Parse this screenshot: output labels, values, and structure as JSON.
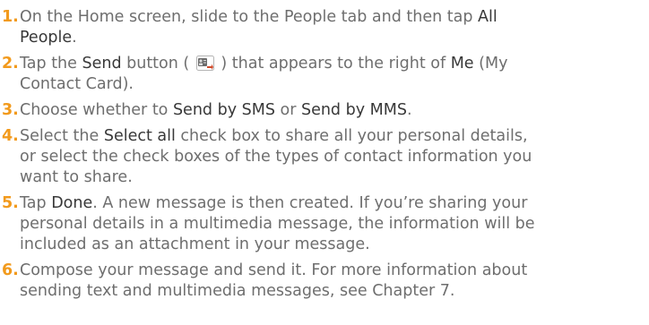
{
  "steps": [
    {
      "number": "1.",
      "parts": [
        "On the Home screen, slide to the People tab and then tap ",
        "All",
        "People",
        "."
      ]
    },
    {
      "number": "2.",
      "parts": [
        "Tap the ",
        "Send",
        " button ( ",
        " ) that appears to the right of ",
        "Me",
        " (My",
        "Contact Card)."
      ],
      "icon": "send-contact-card-icon"
    },
    {
      "number": "3.",
      "parts": [
        "Choose whether to ",
        "Send by SMS",
        " or ",
        "Send by MMS",
        "."
      ]
    },
    {
      "number": "4.",
      "parts": [
        "Select the ",
        "Select all",
        " check box to share all your personal details,",
        "or select the check boxes of the types of contact information you",
        "want to share."
      ]
    },
    {
      "number": "5.",
      "parts": [
        "Tap ",
        "Done",
        ". A new message is then created. If you’re sharing your",
        "personal details in a multimedia message, the information will be",
        "included as an attachment in your message."
      ]
    },
    {
      "number": "6.",
      "parts": [
        "Compose your message and send it. For more information about",
        "sending text and multimedia messages, see Chapter 7."
      ]
    }
  ],
  "colors": {
    "number": "#f29a1c",
    "text": "#6e6e6e",
    "emphasis": "#383838"
  }
}
